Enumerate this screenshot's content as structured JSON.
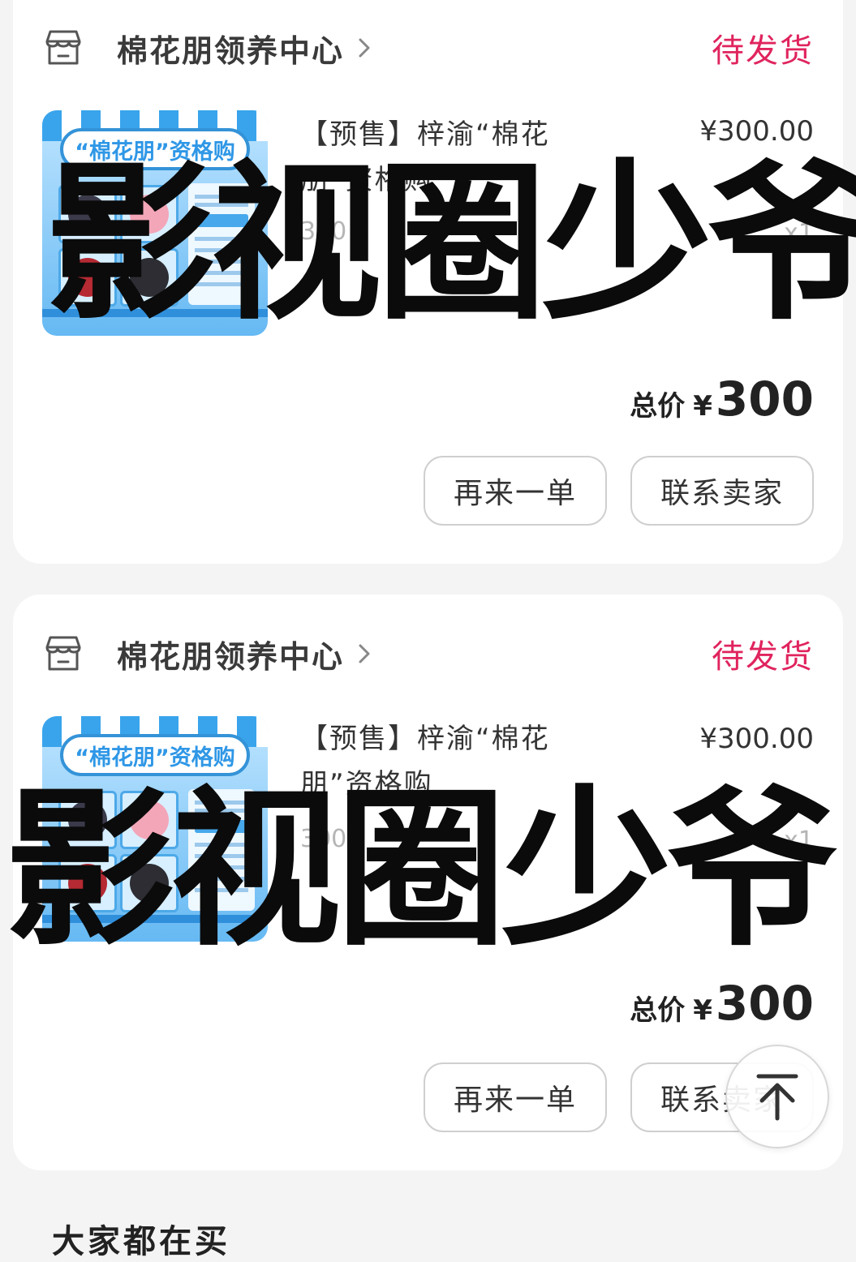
{
  "orders": [
    {
      "shop_name": "棉花朋领养中心",
      "status": "待发货",
      "thumbnail_banner": "“棉花朋”资格购",
      "product_title": "【预售】梓渝“棉花朋”资格购",
      "unit_price": "¥300.00",
      "spec": "300",
      "quantity": "x1",
      "total_label": "总价",
      "total_currency": "¥",
      "total_amount": "300",
      "buttons": {
        "reorder": "再来一单",
        "contact_seller": "联系卖家"
      }
    },
    {
      "shop_name": "棉花朋领养中心",
      "status": "待发货",
      "thumbnail_banner": "“棉花朋”资格购",
      "product_title": "【预售】梓渝“棉花朋”资格购",
      "unit_price": "¥300.00",
      "spec": "300",
      "quantity": "x1",
      "total_label": "总价",
      "total_currency": "¥",
      "total_amount": "300",
      "buttons": {
        "reorder": "再来一单",
        "contact_seller": "联系卖家"
      }
    }
  ],
  "watermark": "影视圈少爷",
  "next_section_title": "大家都在买",
  "icons": {
    "shop": "shop-icon",
    "chevron": "chevron-right-icon",
    "back_to_top": "arrow-up-icon"
  },
  "colors": {
    "status": "#e0245e",
    "background": "#f4f4f4",
    "card": "#ffffff"
  }
}
